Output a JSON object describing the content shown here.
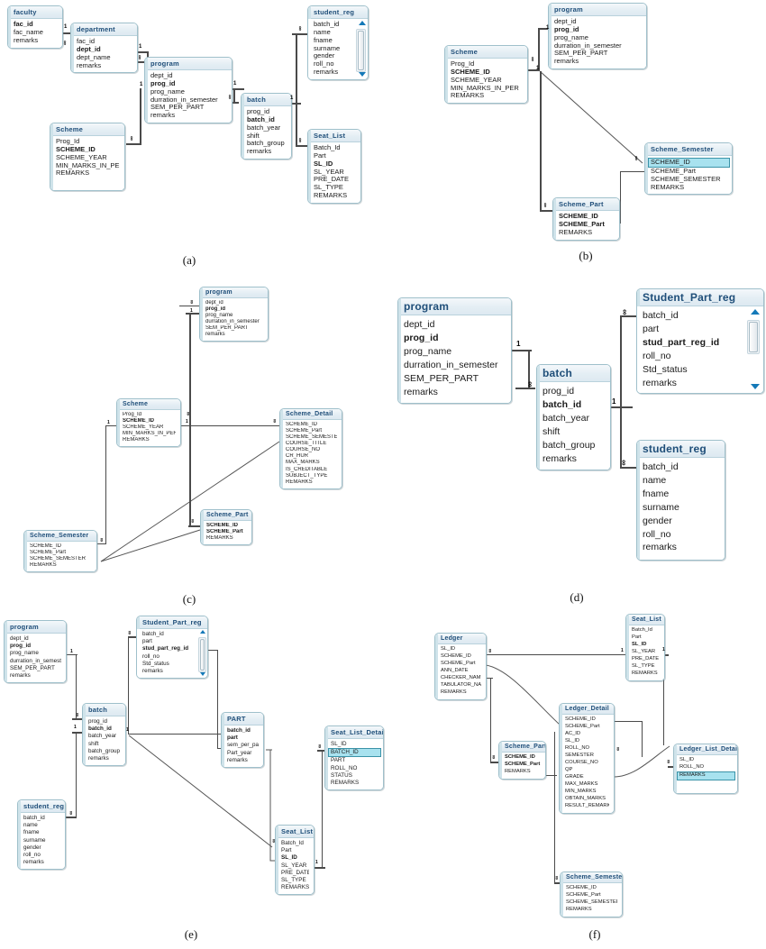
{
  "figure": {
    "panels": [
      {
        "id": "a",
        "label": "(a)"
      },
      {
        "id": "b",
        "label": "(b)"
      },
      {
        "id": "c",
        "label": "(c)"
      },
      {
        "id": "d",
        "label": "(d)"
      },
      {
        "id": "e",
        "label": "(e)"
      },
      {
        "id": "f",
        "label": "(f)"
      }
    ],
    "colors": {
      "header_text": "#1f4e79",
      "header_bg": "#e4eef4",
      "border": "#9fc0cb",
      "selected_row": "#a8e2ef",
      "connector": "#4a4a4a"
    },
    "cardinality": {
      "one": "1",
      "many": "∞"
    }
  },
  "panel_a": {
    "label": "(a)",
    "tables": {
      "faculty": {
        "title": "faculty",
        "fields": [
          "fac_id",
          "fac_name",
          "remarks"
        ],
        "pk": [
          "fac_id"
        ]
      },
      "department": {
        "title": "department",
        "fields": [
          "fac_id",
          "dept_id",
          "dept_name",
          "remarks"
        ],
        "pk": [
          "dept_id"
        ]
      },
      "program": {
        "title": "program",
        "fields": [
          "dept_id",
          "prog_id",
          "prog_name",
          "durration_in_semester",
          "SEM_PER_PART",
          "remarks"
        ],
        "pk": [
          "prog_id"
        ]
      },
      "batch": {
        "title": "batch",
        "fields": [
          "prog_id",
          "batch_id",
          "batch_year",
          "shift",
          "batch_group",
          "remarks"
        ],
        "pk": [
          "batch_id"
        ]
      },
      "scheme": {
        "title": "Scheme",
        "fields": [
          "Prog_Id",
          "SCHEME_ID",
          "SCHEME_YEAR",
          "MIN_MARKS_IN_PER",
          "REMARKS"
        ],
        "pk": [
          "SCHEME_ID"
        ]
      },
      "student_reg": {
        "title": "student_reg",
        "fields": [
          "batch_id",
          "name",
          "fname",
          "surname",
          "gender",
          "roll_no",
          "remarks"
        ],
        "pk": [],
        "scroll": true
      },
      "seat_list": {
        "title": "Seat_List",
        "fields": [
          "Batch_Id",
          "Part",
          "SL_ID",
          "SL_YEAR",
          "PRE_DATE",
          "SL_TYPE",
          "REMARKS"
        ],
        "pk": [
          "SL_ID"
        ]
      }
    },
    "relations": [
      {
        "from": "faculty",
        "to": "department",
        "from_card": "1",
        "to_card": "∞"
      },
      {
        "from": "department",
        "to": "program",
        "from_card": "1",
        "to_card": "∞"
      },
      {
        "from": "program",
        "to": "batch",
        "from_card": "1",
        "to_card": "∞"
      },
      {
        "from": "program",
        "to": "scheme",
        "from_card": "1",
        "to_card": "∞"
      },
      {
        "from": "batch",
        "to": "student_reg",
        "from_card": "1",
        "to_card": "∞"
      },
      {
        "from": "batch",
        "to": "seat_list",
        "from_card": "1",
        "to_card": "∞"
      }
    ]
  },
  "panel_b": {
    "label": "(b)",
    "tables": {
      "program": {
        "title": "program",
        "fields": [
          "dept_id",
          "prog_id",
          "prog_name",
          "durration_in_semester",
          "SEM_PER_PART",
          "remarks"
        ],
        "pk": [
          "prog_id"
        ]
      },
      "scheme": {
        "title": "Scheme",
        "fields": [
          "Prog_Id",
          "SCHEME_ID",
          "SCHEME_YEAR",
          "MIN_MARKS_IN_PER",
          "REMARKS"
        ],
        "pk": [
          "SCHEME_ID"
        ]
      },
      "scheme_semester": {
        "title": "Scheme_Semester",
        "fields": [
          "SCHEME_ID",
          "SCHEME_Part",
          "SCHEME_SEMESTER",
          "REMARKS"
        ],
        "pk": [],
        "selected": "SCHEME_ID"
      },
      "scheme_part": {
        "title": "Scheme_Part",
        "fields": [
          "SCHEME_ID",
          "SCHEME_Part",
          "REMARKS"
        ],
        "pk": [
          "SCHEME_ID",
          "SCHEME_Part"
        ]
      }
    },
    "relations": [
      {
        "from": "program",
        "to": "scheme",
        "from_card": "1",
        "to_card": "∞"
      },
      {
        "from": "scheme",
        "to": "scheme_semester",
        "from_card": "1",
        "to_card": "∞"
      },
      {
        "from": "scheme",
        "to": "scheme_part",
        "from_card": "1",
        "to_card": "∞"
      }
    ]
  },
  "panel_c": {
    "label": "(c)",
    "tables": {
      "program": {
        "title": "program",
        "fields": [
          "dept_id",
          "prog_id",
          "prog_name",
          "durration_in_semester",
          "SEM_PER_PART",
          "remarks"
        ],
        "pk": [
          "prog_id"
        ]
      },
      "scheme": {
        "title": "Scheme",
        "fields": [
          "Prog_Id",
          "SCHEME_ID",
          "SCHEME_YEAR",
          "MIN_MARKS_IN_PER",
          "REMARKS"
        ],
        "pk": [
          "SCHEME_ID"
        ]
      },
      "scheme_detail": {
        "title": "Scheme_Detail",
        "fields": [
          "SCHEME_ID",
          "SCHEME_Part",
          "SCHEME_SEMESTER",
          "COURSE_TITLE",
          "COURSE_NO",
          "CR_HUR",
          "MAX_MARKS",
          "IS_CREDITABLE",
          "SUBJECT_TYPE",
          "REMARKS"
        ],
        "pk": []
      },
      "scheme_part": {
        "title": "Scheme_Part",
        "fields": [
          "SCHEME_ID",
          "SCHEME_Part",
          "REMARKS"
        ],
        "pk": [
          "SCHEME_ID",
          "SCHEME_Part"
        ]
      },
      "scheme_semester": {
        "title": "Scheme_Semester",
        "fields": [
          "SCHEME_ID",
          "SCHEME_Part",
          "SCHEME_SEMESTER",
          "REMARKS"
        ],
        "pk": []
      }
    },
    "relations": [
      {
        "from": "program",
        "to": "scheme",
        "from_card": "1",
        "to_card": "∞"
      },
      {
        "from": "scheme",
        "to": "scheme_detail",
        "from_card": "1",
        "to_card": "∞"
      },
      {
        "from": "scheme",
        "to": "scheme_part",
        "from_card": "1",
        "to_card": "∞"
      },
      {
        "from": "scheme",
        "to": "scheme_semester",
        "from_card": "1",
        "to_card": "∞"
      }
    ]
  },
  "panel_d": {
    "label": "(d)",
    "tables": {
      "program": {
        "title": "program",
        "fields": [
          "dept_id",
          "prog_id",
          "prog_name",
          "durration_in_semester",
          "SEM_PER_PART",
          "remarks"
        ],
        "pk": [
          "prog_id"
        ]
      },
      "batch": {
        "title": "batch",
        "fields": [
          "prog_id",
          "batch_id",
          "batch_year",
          "shift",
          "batch_group",
          "remarks"
        ],
        "pk": [
          "batch_id"
        ]
      },
      "student_part_reg": {
        "title": "Student_Part_reg",
        "fields": [
          "batch_id",
          "part",
          "stud_part_reg_id",
          "roll_no",
          "Std_status",
          "remarks"
        ],
        "pk": [
          "stud_part_reg_id"
        ],
        "scroll": true
      },
      "student_reg": {
        "title": "student_reg",
        "fields": [
          "batch_id",
          "name",
          "fname",
          "surname",
          "gender",
          "roll_no",
          "remarks"
        ],
        "pk": []
      }
    },
    "relations": [
      {
        "from": "program",
        "to": "batch",
        "from_card": "1",
        "to_card": "∞"
      },
      {
        "from": "batch",
        "to": "student_part_reg",
        "from_card": "1",
        "to_card": "∞"
      },
      {
        "from": "batch",
        "to": "student_reg",
        "from_card": "1",
        "to_card": "∞"
      }
    ]
  },
  "panel_e": {
    "label": "(e)",
    "tables": {
      "program": {
        "title": "program",
        "fields": [
          "dept_id",
          "prog_id",
          "prog_name",
          "durration_in_semester",
          "SEM_PER_PART",
          "remarks"
        ],
        "pk": [
          "prog_id"
        ]
      },
      "batch": {
        "title": "batch",
        "fields": [
          "prog_id",
          "batch_id",
          "batch_year",
          "shift",
          "batch_group",
          "remarks"
        ],
        "pk": [
          "batch_id"
        ]
      },
      "student_reg": {
        "title": "student_reg",
        "fields": [
          "batch_id",
          "name",
          "fname",
          "surname",
          "gender",
          "roll_no",
          "remarks"
        ],
        "pk": []
      },
      "student_part_reg": {
        "title": "Student_Part_reg",
        "fields": [
          "batch_id",
          "part",
          "stud_part_reg_id",
          "roll_no",
          "Std_status",
          "remarks"
        ],
        "pk": [
          "stud_part_reg_id"
        ],
        "scroll": true
      },
      "part": {
        "title": "PART",
        "fields": [
          "batch_id",
          "part",
          "sem_per_part",
          "Part_year",
          "remarks"
        ],
        "pk": [
          "batch_id",
          "part"
        ]
      },
      "seat_list": {
        "title": "Seat_List",
        "fields": [
          "Batch_Id",
          "Part",
          "SL_ID",
          "SL_YEAR",
          "PRE_DATE",
          "SL_TYPE",
          "REMARKS"
        ],
        "pk": [
          "SL_ID"
        ]
      },
      "seat_list_detail": {
        "title": "Seat_List_Detail",
        "fields": [
          "SL_ID",
          "BATCH_ID",
          "PART",
          "ROLL_NO",
          "STATUS",
          "REMARKS"
        ],
        "pk": [],
        "selected": "BATCH_ID"
      }
    },
    "relations": [
      {
        "from": "program",
        "to": "batch",
        "from_card": "1",
        "to_card": "∞"
      },
      {
        "from": "batch",
        "to": "student_reg",
        "from_card": "1",
        "to_card": "∞"
      },
      {
        "from": "batch",
        "to": "student_part_reg",
        "from_card": "1",
        "to_card": "∞"
      },
      {
        "from": "batch",
        "to": "part",
        "from_card": "1",
        "to_card": "∞"
      },
      {
        "from": "batch",
        "to": "seat_list",
        "from_card": "1",
        "to_card": "∞"
      },
      {
        "from": "seat_list",
        "to": "seat_list_detail",
        "from_card": "1",
        "to_card": "∞"
      }
    ]
  },
  "panel_f": {
    "label": "(f)",
    "tables": {
      "ledger": {
        "title": "Ledger",
        "fields": [
          "SL_ID",
          "SCHEME_ID",
          "SCHEME_Part",
          "ANN_DATE",
          "CHECKER_NAME",
          "TABULATOR_NAME",
          "REMARKS"
        ],
        "pk": []
      },
      "seat_list": {
        "title": "Seat_List",
        "fields": [
          "Batch_Id",
          "Part",
          "SL_ID",
          "SL_YEAR",
          "PRE_DATE",
          "SL_TYPE",
          "REMARKS"
        ],
        "pk": [
          "SL_ID"
        ]
      },
      "scheme_part": {
        "title": "Scheme_Part",
        "fields": [
          "SCHEME_ID",
          "SCHEME_Part",
          "REMARKS"
        ],
        "pk": [
          "SCHEME_ID",
          "SCHEME_Part"
        ]
      },
      "ledger_detail": {
        "title": "Ledger_Detail",
        "fields": [
          "SCHEME_ID",
          "SCHEME_Part",
          "AC_ID",
          "SL_ID",
          "ROLL_NO",
          "SEMESTER",
          "COURSE_NO",
          "QP",
          "GRADE",
          "MAX_MARKS",
          "MIN_MARKS",
          "OBTAIN_MARKS",
          "RESULT_REMARKS"
        ],
        "pk": []
      },
      "ledger_list_detail": {
        "title": "Ledger_List_Detail",
        "fields": [
          "SL_ID",
          "ROLL_NO",
          "REMARKS"
        ],
        "pk": [],
        "selected": "REMARKS"
      },
      "scheme_semester": {
        "title": "Scheme_Semester",
        "fields": [
          "SCHEME_ID",
          "SCHEME_Part",
          "SCHEME_SEMESTER",
          "REMARKS"
        ],
        "pk": []
      }
    },
    "relations": [
      {
        "from": "seat_list",
        "to": "ledger",
        "from_card": "1",
        "to_card": "∞"
      },
      {
        "from": "seat_list",
        "to": "ledger_detail",
        "from_card": "1",
        "to_card": "∞"
      },
      {
        "from": "seat_list",
        "to": "ledger_list_detail",
        "from_card": "1",
        "to_card": "∞"
      },
      {
        "from": "scheme_part",
        "to": "ledger",
        "from_card": "1",
        "to_card": "∞"
      },
      {
        "from": "scheme_semester",
        "to": "ledger_detail",
        "from_card": "1",
        "to_card": "∞"
      }
    ]
  }
}
